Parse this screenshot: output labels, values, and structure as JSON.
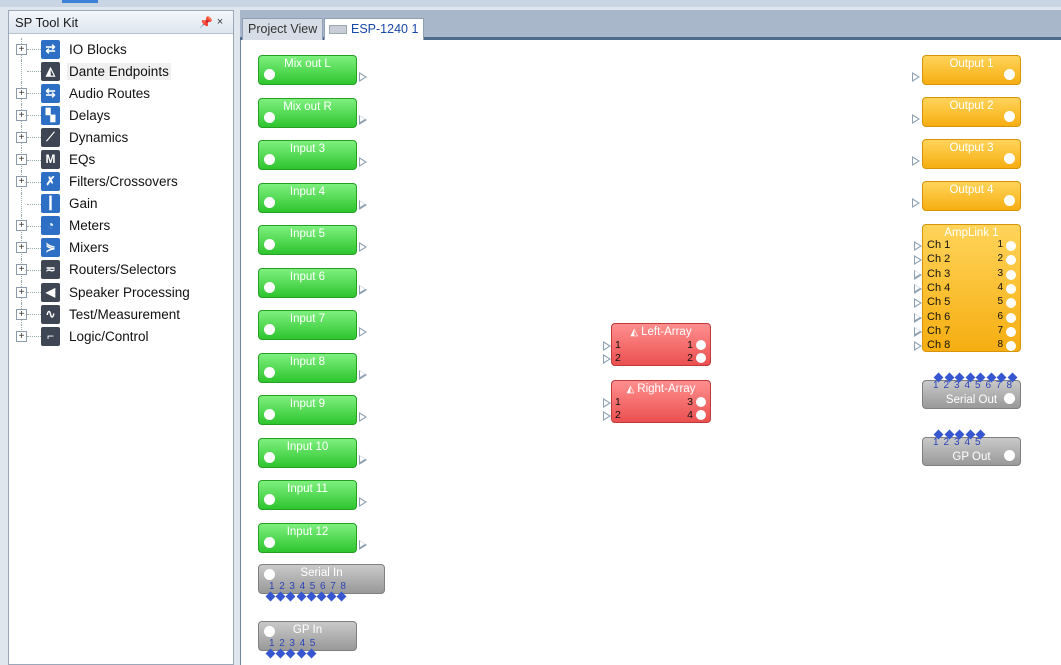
{
  "toolkit": {
    "title": "SP Tool Kit",
    "pin_icon": "pin-icon",
    "close_icon": "close-icon",
    "items": [
      {
        "label": "IO Blocks",
        "expandable": true,
        "icon": "io-blocks-icon"
      },
      {
        "label": "Dante Endpoints",
        "expandable": false,
        "icon": "dante-icon",
        "selected": true
      },
      {
        "label": "Audio Routes",
        "expandable": true,
        "icon": "audio-routes-icon"
      },
      {
        "label": "Delays",
        "expandable": true,
        "icon": "delays-icon"
      },
      {
        "label": "Dynamics",
        "expandable": true,
        "icon": "dynamics-icon"
      },
      {
        "label": "EQs",
        "expandable": true,
        "icon": "eq-icon"
      },
      {
        "label": "Filters/Crossovers",
        "expandable": true,
        "icon": "filters-icon"
      },
      {
        "label": "Gain",
        "expandable": false,
        "icon": "gain-icon"
      },
      {
        "label": "Meters",
        "expandable": true,
        "icon": "meters-icon"
      },
      {
        "label": "Mixers",
        "expandable": true,
        "icon": "mixers-icon"
      },
      {
        "label": "Routers/Selectors",
        "expandable": true,
        "icon": "routers-icon"
      },
      {
        "label": "Speaker Processing",
        "expandable": true,
        "icon": "speaker-icon"
      },
      {
        "label": "Test/Measurement",
        "expandable": true,
        "icon": "test-icon"
      },
      {
        "label": "Logic/Control",
        "expandable": true,
        "icon": "logic-icon"
      }
    ]
  },
  "tabs": {
    "project_view": "Project View",
    "device": "ESP-1240 1"
  },
  "inputs": [
    "Mix out L",
    "Mix out R",
    "Input 3",
    "Input 4",
    "Input 5",
    "Input 6",
    "Input 7",
    "Input 8",
    "Input 9",
    "Input 10",
    "Input 11",
    "Input 12"
  ],
  "serial_in": {
    "label": "Serial In",
    "pins": [
      "1",
      "2",
      "3",
      "4",
      "5",
      "6",
      "7",
      "8"
    ]
  },
  "gp_in": {
    "label": "GP In",
    "pins": [
      "1",
      "2",
      "3",
      "4",
      "5"
    ]
  },
  "outputs": [
    "Output 1",
    "Output 2",
    "Output 3",
    "Output 4"
  ],
  "amplink": {
    "label": "AmpLink 1",
    "channels": [
      "Ch 1",
      "Ch 2",
      "Ch 3",
      "Ch 4",
      "Ch 5",
      "Ch 6",
      "Ch 7",
      "Ch 8"
    ],
    "outs": [
      "1",
      "2",
      "3",
      "4",
      "5",
      "6",
      "7",
      "8"
    ]
  },
  "left_array": {
    "label": "Left-Array",
    "ins": [
      "1",
      "2"
    ],
    "outs": [
      "1",
      "2"
    ]
  },
  "right_array": {
    "label": "Right-Array",
    "ins": [
      "1",
      "2"
    ],
    "outs": [
      "3",
      "4"
    ]
  },
  "serial_out": {
    "label": "Serial Out",
    "pins": [
      "1",
      "2",
      "3",
      "4",
      "5",
      "6",
      "7",
      "8"
    ]
  },
  "gp_out": {
    "label": "GP Out",
    "pins": [
      "1",
      "2",
      "3",
      "4",
      "5"
    ]
  },
  "colors": {
    "input": "#3fd43f",
    "output": "#f8b520",
    "array": "#ee6262",
    "serial": "#aaaaaa",
    "pin": "#3657cf"
  }
}
